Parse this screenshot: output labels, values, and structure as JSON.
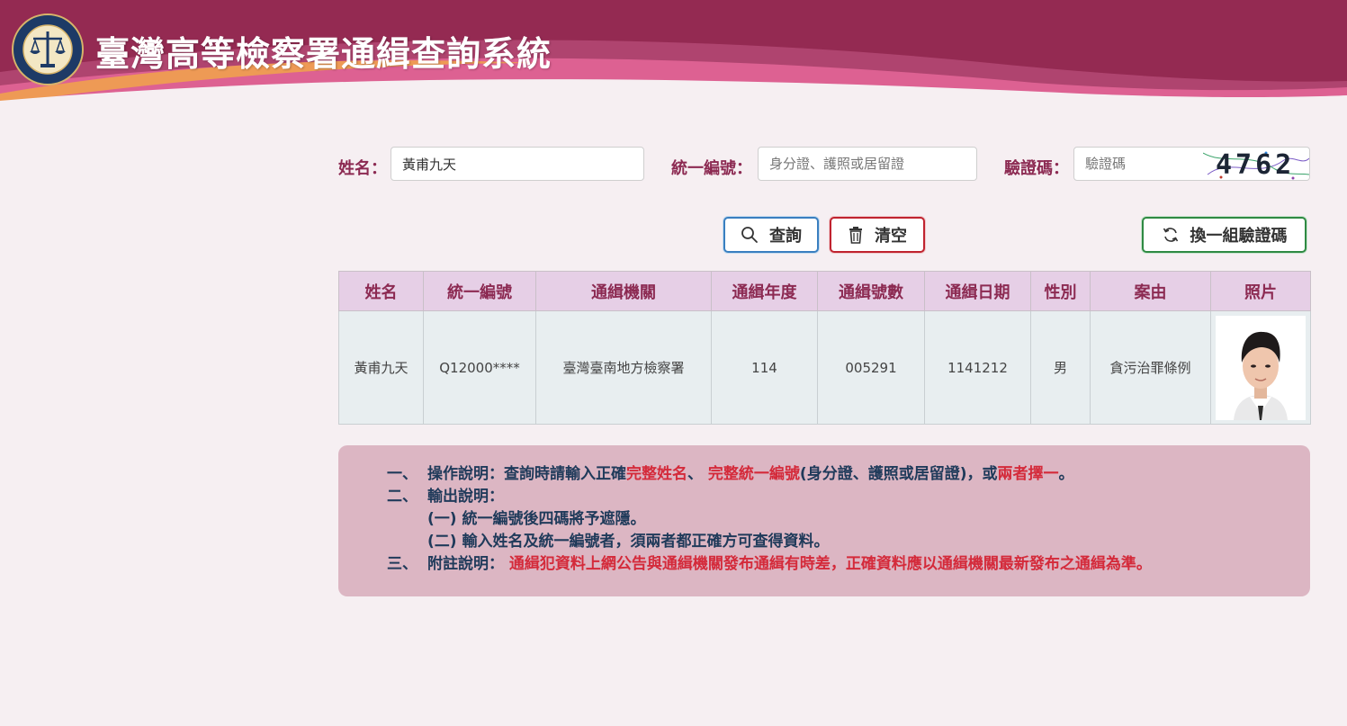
{
  "header": {
    "title": "臺灣高等檢察署通緝查詢系統"
  },
  "form": {
    "name_label": "姓名：",
    "name_value": "黃甫九天",
    "id_label": "統一編號：",
    "id_placeholder": "身分證、護照或居留證",
    "captcha_label": "驗證碼：",
    "captcha_placeholder": "驗證碼",
    "captcha_code": "4762"
  },
  "buttons": {
    "query": "查詢",
    "clear": "清空",
    "refresh_captcha": "換一組驗證碼"
  },
  "table": {
    "headers": [
      "姓名",
      "統一編號",
      "通緝機關",
      "通緝年度",
      "通緝號數",
      "通緝日期",
      "性別",
      "案由",
      "照片"
    ],
    "rows": [
      [
        "黃甫九天",
        "Q12000****",
        "臺灣臺南地方檢察署",
        "114",
        "005291",
        "1141212",
        "男",
        "貪污治罪條例"
      ]
    ]
  },
  "notes": {
    "l1_num": "一、",
    "l1_a": "操作說明：查詢時請輸入正確",
    "l1_b": "完整姓名",
    "l1_c": "、 ",
    "l1_d": "完整統一編號",
    "l1_e": "(身分證、護照或居留證)，或",
    "l1_f": "兩者擇一",
    "l1_g": "。",
    "l2_num": "二、",
    "l2_a": "輸出說明：",
    "l3": "(一) 統一編號後四碼將予遮隱。",
    "l4": "(二) 輸入姓名及統一編號者，須兩者都正確方可查得資料。",
    "l5_num": "三、",
    "l5_a": "附註說明：",
    "l5_b": "通緝犯資料上網公告與通緝機關發布通緝有時差，正確資料應以通緝機關最新發布之通緝為準。"
  },
  "colors": {
    "header_bg": "#942a52",
    "accent": "#8c2a52",
    "notes_bg": "#dcb6c3",
    "highlight_red": "#d42a3a"
  }
}
